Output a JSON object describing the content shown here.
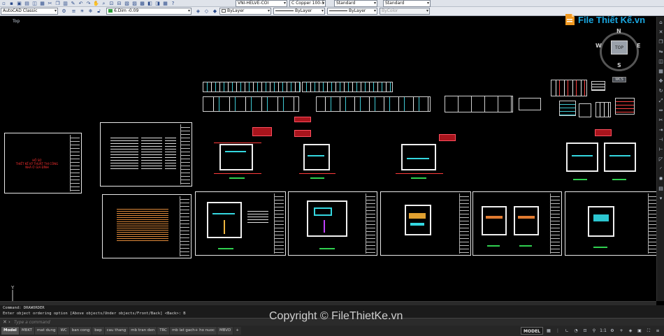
{
  "toolbar": {
    "workspace": "AutoCAD Classic",
    "layer": "6.Dim -0.09",
    "text_style": "VNI-HELVE-COI",
    "dim_style": "C Copper 100-5",
    "table_style": "Standard",
    "multileader_style": "Standard",
    "color": "ByLayer",
    "linetype": "ByLayer",
    "lineweight": "ByLayer",
    "plotstyle": "ByColor"
  },
  "viewport": {
    "label": "Top"
  },
  "viewcube": {
    "top_label": "TOP",
    "north": "N",
    "south": "S",
    "east": "E",
    "west": "W",
    "wcs_label": "WCS"
  },
  "logo": {
    "text": "File Thiết Kế.vn"
  },
  "ucs": {
    "y_label": "Y",
    "x_label": "X"
  },
  "title_sheet": {
    "line1": "HỒ SƠ",
    "line2": "THIẾT KẾ KỸ THUẬT THI CÔNG",
    "line3": "NHÀ Ở GIA ĐÌNH"
  },
  "command": {
    "history_1": "Command:  DRAWORDER",
    "history_2": "Enter object ordering option [Above objects/Under objects/Front/Back] <Back>: B",
    "placeholder": "Type a command"
  },
  "layout_tabs": [
    {
      "label": "Model",
      "active": true
    },
    {
      "label": "MBKT",
      "active": false
    },
    {
      "label": "mat dung",
      "active": false
    },
    {
      "label": "WC",
      "active": false
    },
    {
      "label": "ban cong",
      "active": false
    },
    {
      "label": "bep",
      "active": false
    },
    {
      "label": "cau thang",
      "active": false
    },
    {
      "label": "mb tran den",
      "active": false
    },
    {
      "label": "TRC",
      "active": false
    },
    {
      "label": "mb lat gach+ ho nuoc",
      "active": false
    },
    {
      "label": "MBVD",
      "active": false
    }
  ],
  "add_tab_label": "+",
  "status_bar": {
    "model_button": "MODEL",
    "scale": "1:1"
  },
  "watermark": "Copyright © FileThietKe.vn"
}
